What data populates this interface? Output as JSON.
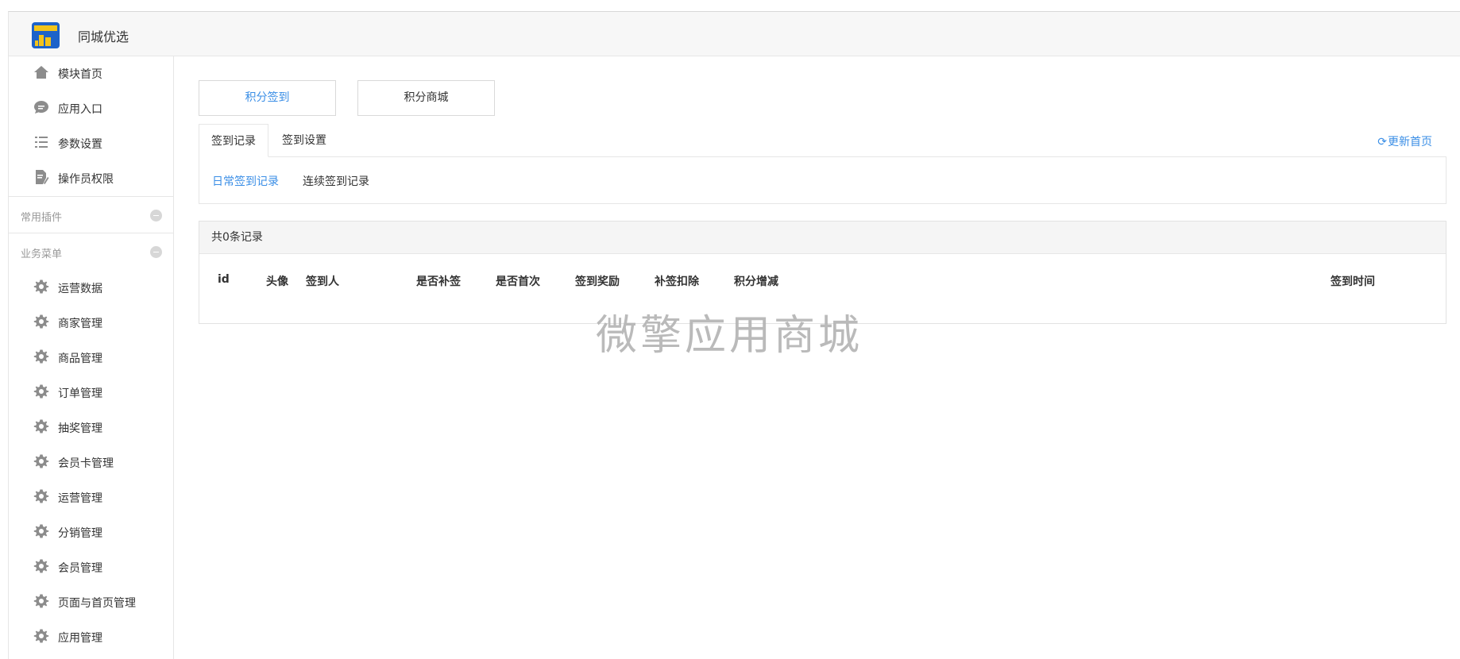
{
  "header": {
    "title": "同城优选"
  },
  "sidebar": {
    "top_items": [
      {
        "label": "模块首页",
        "icon": "home-icon"
      },
      {
        "label": "应用入口",
        "icon": "chat-icon"
      },
      {
        "label": "参数设置",
        "icon": "list-settings-icon"
      },
      {
        "label": "操作员权限",
        "icon": "document-edit-icon"
      }
    ],
    "sections": [
      {
        "label": "常用插件"
      },
      {
        "label": "业务菜单"
      }
    ],
    "menu_items": [
      {
        "label": "运营数据",
        "icon": "gear-icon"
      },
      {
        "label": "商家管理",
        "icon": "gear-icon"
      },
      {
        "label": "商品管理",
        "icon": "gear-icon"
      },
      {
        "label": "订单管理",
        "icon": "gear-icon"
      },
      {
        "label": "抽奖管理",
        "icon": "gear-icon"
      },
      {
        "label": "会员卡管理",
        "icon": "gear-icon"
      },
      {
        "label": "运营管理",
        "icon": "gear-icon"
      },
      {
        "label": "分销管理",
        "icon": "gear-icon"
      },
      {
        "label": "会员管理",
        "icon": "gear-icon"
      },
      {
        "label": "页面与首页管理",
        "icon": "gear-icon"
      },
      {
        "label": "应用管理",
        "icon": "gear-icon"
      }
    ]
  },
  "main": {
    "top_buttons": [
      {
        "label": "积分签到",
        "active": true
      },
      {
        "label": "积分商城",
        "active": false
      }
    ],
    "tabs": [
      {
        "label": "签到记录",
        "active": true
      },
      {
        "label": "签到设置",
        "active": false
      }
    ],
    "refresh_label": "更新首页",
    "sub_tabs": [
      {
        "label": "日常签到记录",
        "active": true
      },
      {
        "label": "连续签到记录",
        "active": false
      }
    ],
    "table": {
      "summary": "共0条记录",
      "columns": [
        "id",
        "头像",
        "签到人",
        "是否补签",
        "是否首次",
        "签到奖励",
        "补签扣除",
        "积分增减",
        "签到时间"
      ],
      "rows": []
    }
  },
  "watermark": "微擎应用商城",
  "colors": {
    "accent": "#3a8ee6",
    "icon_gray": "#8c8c8c",
    "section_text": "#999999"
  }
}
